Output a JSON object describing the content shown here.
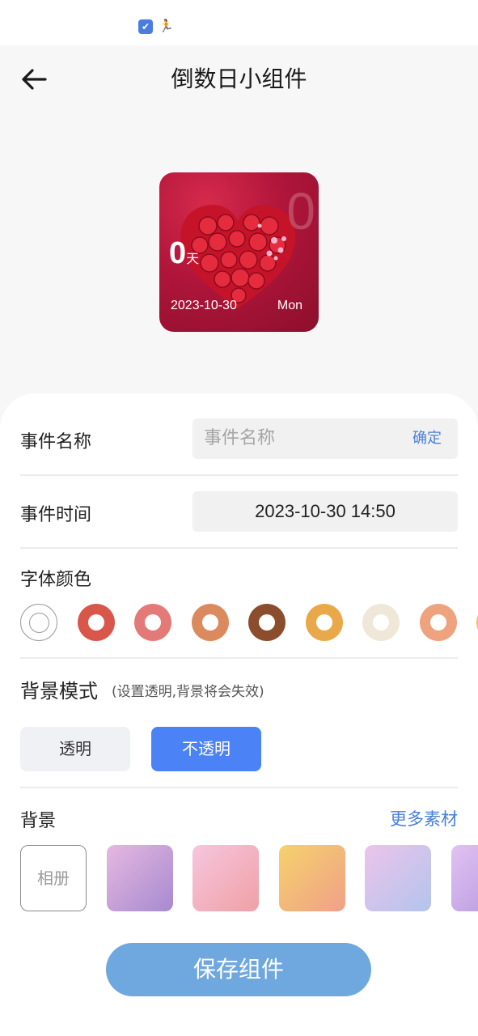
{
  "status_bar": {
    "icons": [
      "app-notification-icon",
      "running-person-icon"
    ]
  },
  "header": {
    "title": "倒数日小组件",
    "back_icon": "back-arrow-icon"
  },
  "preview": {
    "days_value": "0",
    "days_unit": "天",
    "background_digit": "0",
    "date": "2023-10-30",
    "weekday": "Mon",
    "theme_color": "#b0153a"
  },
  "event_name": {
    "label": "事件名称",
    "placeholder": "事件名称",
    "value": "",
    "confirm_label": "确定"
  },
  "event_time": {
    "label": "事件时间",
    "value": "2023-10-30 14:50"
  },
  "font_color": {
    "label": "字体颜色",
    "selected_index": 0,
    "options": [
      "#ffffff",
      "#d9574a",
      "#e37a78",
      "#db8a5e",
      "#8b4d2c",
      "#e9a94a",
      "#efe7d7",
      "#eea27e",
      "#f1c54a"
    ]
  },
  "background_mode": {
    "title": "背景模式",
    "hint": "(设置透明,背景将会失效)",
    "options": [
      "透明",
      "不透明"
    ],
    "selected": "不透明"
  },
  "background": {
    "label": "背景",
    "more_label": "更多素材",
    "album_label": "相册",
    "tiles": [
      [
        "#e6b8e0",
        "#a68ad0"
      ],
      [
        "#f6c6dd",
        "#f0a0a6"
      ],
      [
        "#f5d26c",
        "#f0a088"
      ],
      [
        "#ecc4ea",
        "#b2c4ee"
      ],
      [
        "#e2c2f2",
        "#b396de"
      ]
    ]
  },
  "save_label": "保存组件",
  "colors": {
    "accent": "#4b83f6",
    "link": "#4a7fd6",
    "save": "#6fa7df"
  }
}
